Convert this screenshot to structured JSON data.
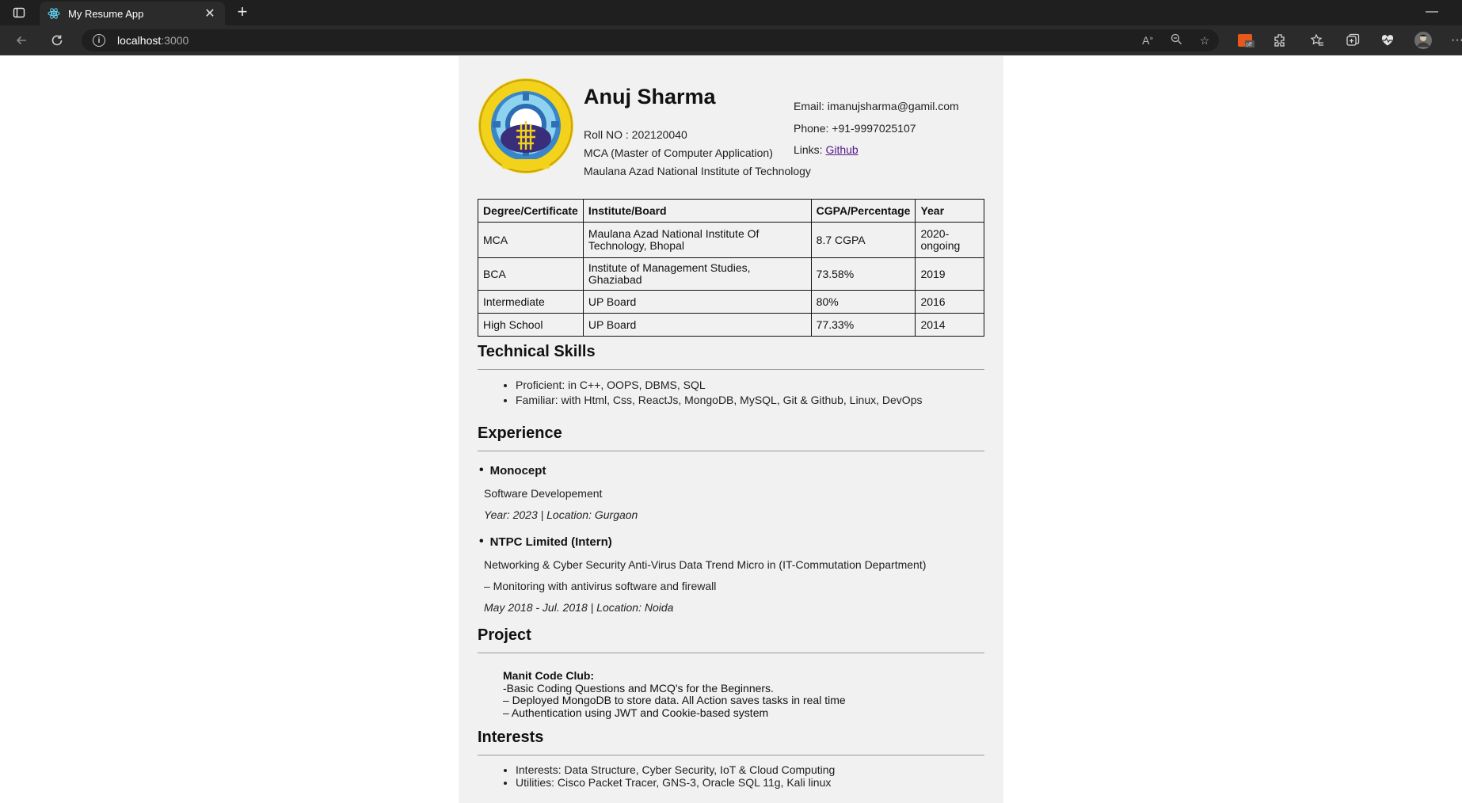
{
  "browser": {
    "tab_title": "My Resume App",
    "url_host": "localhost",
    "url_port": ":3000",
    "icons": [
      "tab-actions-icon",
      "react-favicon-icon",
      "close-icon",
      "plus-icon",
      "minimize-icon",
      "back-icon",
      "refresh-icon",
      "info-icon",
      "read-aloud-icon",
      "zoom-out-icon",
      "add-favorite-icon",
      "extension-off-icon",
      "extensions-icon",
      "favorites-icon",
      "collections-icon",
      "health-icon",
      "profile-icon",
      "more-icon"
    ]
  },
  "resume": {
    "name": "Anuj Sharma",
    "roll_no": "Roll NO : 202120040",
    "program": "MCA (Master of Computer Application)",
    "institute": "Maulana Azad National Institute of Technology",
    "email": "Email: imanujsharma@gamil.com",
    "phone": "Phone: +91-9997025107",
    "links_label": "Links:",
    "github_link": "Github",
    "education": {
      "headers": [
        "Degree/Certificate",
        "Institute/Board",
        "CGPA/Percentage",
        "Year"
      ],
      "rows": [
        [
          "MCA",
          "Maulana Azad National Institute Of Technology, Bhopal",
          "8.7 CGPA",
          "2020-ongoing"
        ],
        [
          "BCA",
          "Institute of Management Studies, Ghaziabad",
          "73.58%",
          "2019"
        ],
        [
          "Intermediate",
          "UP Board",
          "80%",
          "2016"
        ],
        [
          "High School",
          "UP Board",
          "77.33%",
          "2014"
        ]
      ]
    },
    "skills": {
      "heading": "Technical Skills",
      "items": [
        "Proficient: in C++, OOPS, DBMS, SQL",
        "Familiar: with Html, Css, ReactJs, MongoDB, MySQL, Git & Github, Linux, DevOps"
      ]
    },
    "experience": {
      "heading": "Experience",
      "items": [
        {
          "company": "Monocept",
          "lines": [
            "Software Developement"
          ],
          "meta": "Year: 2023 | Location: Gurgaon"
        },
        {
          "company": "NTPC Limited (Intern)",
          "lines": [
            "Networking & Cyber Security Anti-Virus Data Trend Micro in (IT-Commutation Department)",
            "– Monitoring with antivirus software and firewall"
          ],
          "meta": "May 2018 - Jul. 2018 | Location: Noida"
        }
      ]
    },
    "project": {
      "heading": "Project",
      "title": "Manit Code Club:",
      "lines": [
        "-Basic Coding Questions and MCQ's for the Beginners.",
        "– Deployed MongoDB to store data. All Action saves tasks in real time",
        "– Authentication using JWT and Cookie-based system"
      ]
    },
    "interests": {
      "heading": "Interests",
      "items": [
        "Interests: Data Structure, Cyber Security, IoT & Cloud Computing",
        "Utilities: Cisco Packet Tracer, GNS-3, Oracle SQL 11g, Kali linux"
      ]
    },
    "logo_text": "विद्या धनं सर्वधन"
  }
}
